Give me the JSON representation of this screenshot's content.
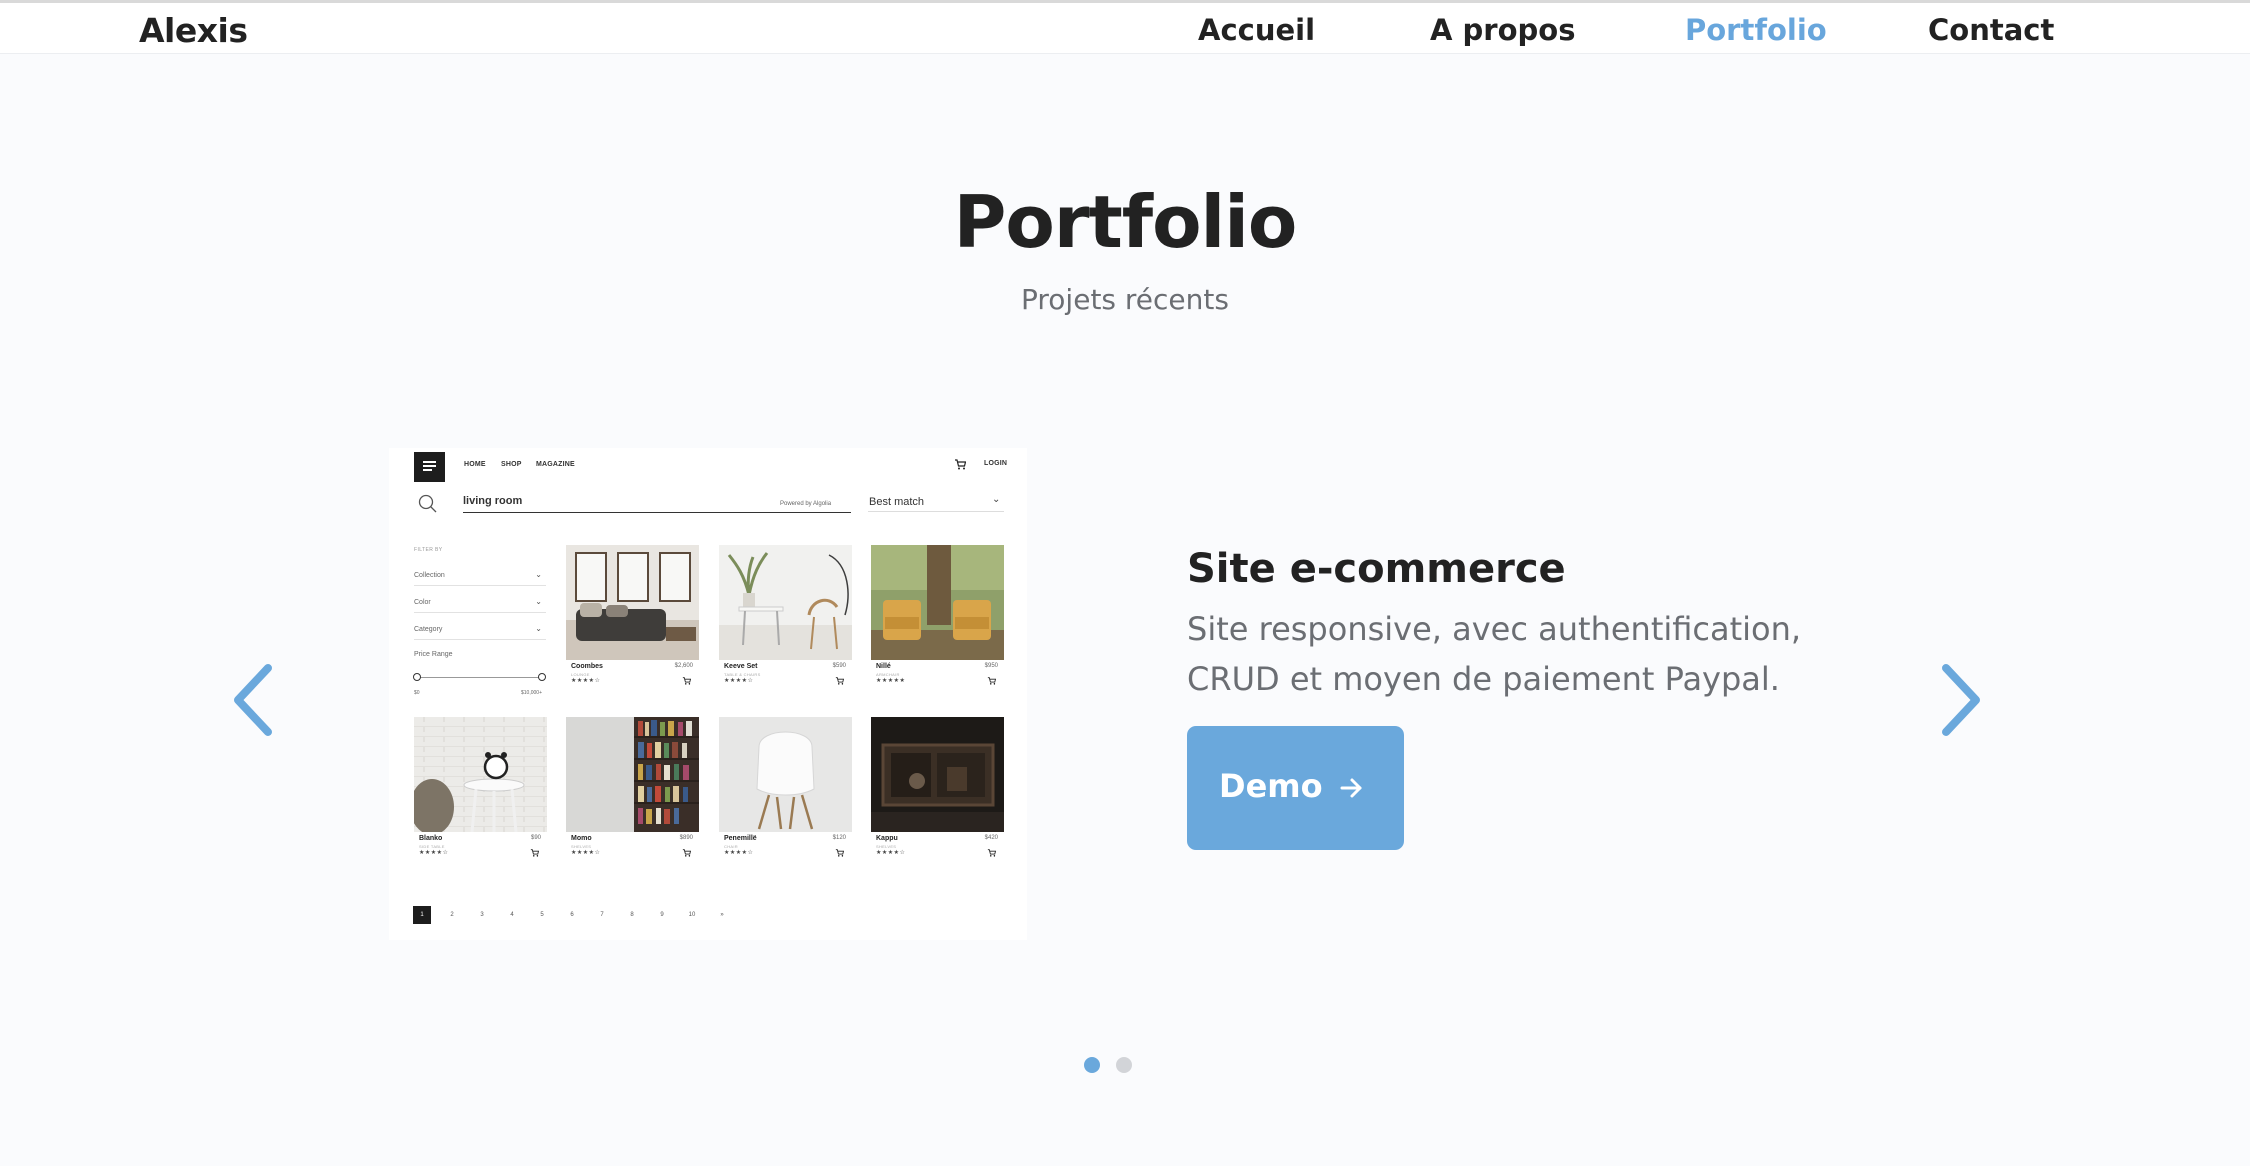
{
  "nav": {
    "logo": "Alexis",
    "items": [
      {
        "label": "Accueil",
        "active": false
      },
      {
        "label": "A propos",
        "active": false
      },
      {
        "label": "Portfolio",
        "active": true
      },
      {
        "label": "Contact",
        "active": false
      }
    ]
  },
  "heading": {
    "title": "Portfolio",
    "subtitle": "Projets récents"
  },
  "project": {
    "title": "Site e-commerce",
    "description": "Site responsive, avec authentification, CRUD et moyen de paiement Paypal.",
    "demo_label": "Demo"
  },
  "mockup": {
    "nav_links": [
      "HOME",
      "SHOP",
      "MAGAZINE"
    ],
    "login": "LOGIN",
    "search_query": "living room",
    "powered_by": "Powered by Algolia",
    "sort": "Best match",
    "filter_by": "FILTER BY",
    "filters": [
      "Collection",
      "Color",
      "Category"
    ],
    "price_range_label": "Price Range",
    "price_min": "$0",
    "price_max": "$10,000+",
    "products": [
      {
        "name": "Coombes",
        "price": "$2,600",
        "category": "LOUNGE",
        "stars": "★★★★☆"
      },
      {
        "name": "Keeve Set",
        "price": "$590",
        "category": "TABLE & CHAIRS",
        "stars": "★★★★☆"
      },
      {
        "name": "Nillé",
        "price": "$950",
        "category": "ARMCHAIR",
        "stars": "★★★★★"
      },
      {
        "name": "Blanko",
        "price": "$90",
        "category": "SIDE TABLE",
        "stars": "★★★★☆"
      },
      {
        "name": "Momo",
        "price": "$890",
        "category": "SHELVES",
        "stars": "★★★★☆"
      },
      {
        "name": "Penemillë",
        "price": "$120",
        "category": "CHAIR",
        "stars": "★★★★☆"
      },
      {
        "name": "Kappu",
        "price": "$420",
        "category": "SHELVES",
        "stars": "★★★★☆"
      }
    ],
    "pages": [
      "1",
      "2",
      "3",
      "4",
      "5",
      "6",
      "7",
      "8",
      "9",
      "10",
      "»"
    ]
  },
  "colors": {
    "accent": "#6aa8dc",
    "text": "#222222",
    "muted": "#6b6e73",
    "background": "#fafbfd"
  },
  "carousel": {
    "slide_count": 2,
    "active_slide": 1
  }
}
